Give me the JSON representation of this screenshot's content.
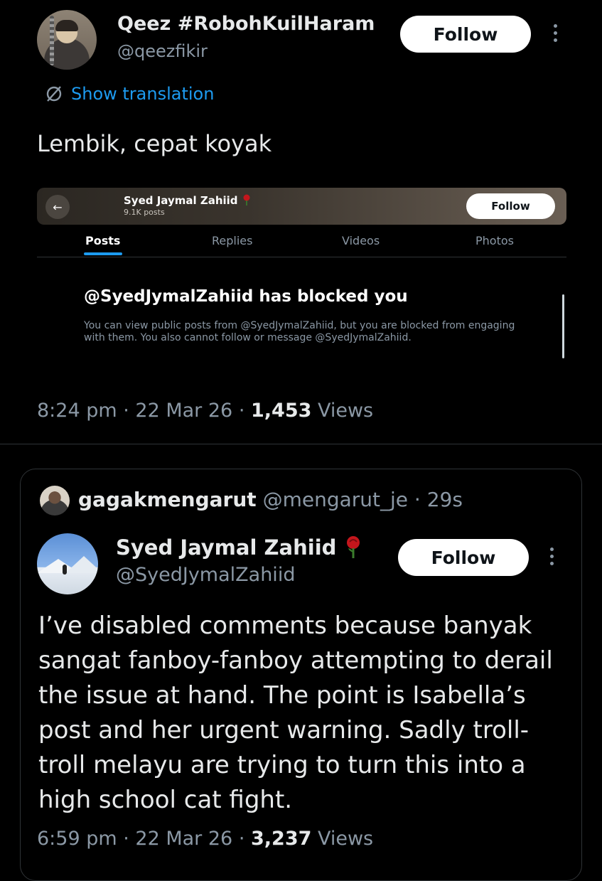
{
  "tweet": {
    "author_name": "Qeez #RobohKuilHaram",
    "author_handle": "@qeezfikir",
    "follow_label": "Follow",
    "translate_label": "Show translation",
    "text": "Lembik, cepat koyak",
    "time": "8:24 pm",
    "date": "22 Mar 26",
    "views_count": "1,453",
    "views_label": "Views"
  },
  "screenshot": {
    "profile_name": "Syed Jaymal Zahiid",
    "posts_count": "9.1K posts",
    "follow_label": "Follow",
    "tabs": [
      "Posts",
      "Replies",
      "Videos",
      "Photos"
    ],
    "blocked_title": "@SyedJymalZahiid has blocked you",
    "blocked_body": "You can view public posts from @SyedJymalZahiid, but you are blocked from engaging with them. You also cannot follow or message @SyedJymalZahiid."
  },
  "quote": {
    "quoter_name": "gagakmengarut",
    "quoter_handle": "@mengarut_je",
    "quoter_time": "29s",
    "author_name": "Syed Jaymal Zahiid",
    "author_handle": "@SyedJymalZahiid",
    "follow_label": "Follow",
    "text": "I’ve disabled comments because banyak sangat fanboy-fanboy attempting to derail the issue at hand. The point is Isabella’s post and her urgent warning. Sadly troll-troll melayu are trying to turn this into a high school cat fight.",
    "time": "6:59 pm",
    "date": "22 Mar 26",
    "views_count": "3,237",
    "views_label": "Views"
  },
  "icons": {
    "rose": "rose-icon",
    "translate": "translate-icon",
    "back": "back-arrow-icon",
    "more": "more-icon"
  },
  "colors": {
    "background": "#000000",
    "text": "#e7e9ea",
    "muted": "#8b98a5",
    "link": "#1d9bf0",
    "rose": "#c4161c"
  }
}
